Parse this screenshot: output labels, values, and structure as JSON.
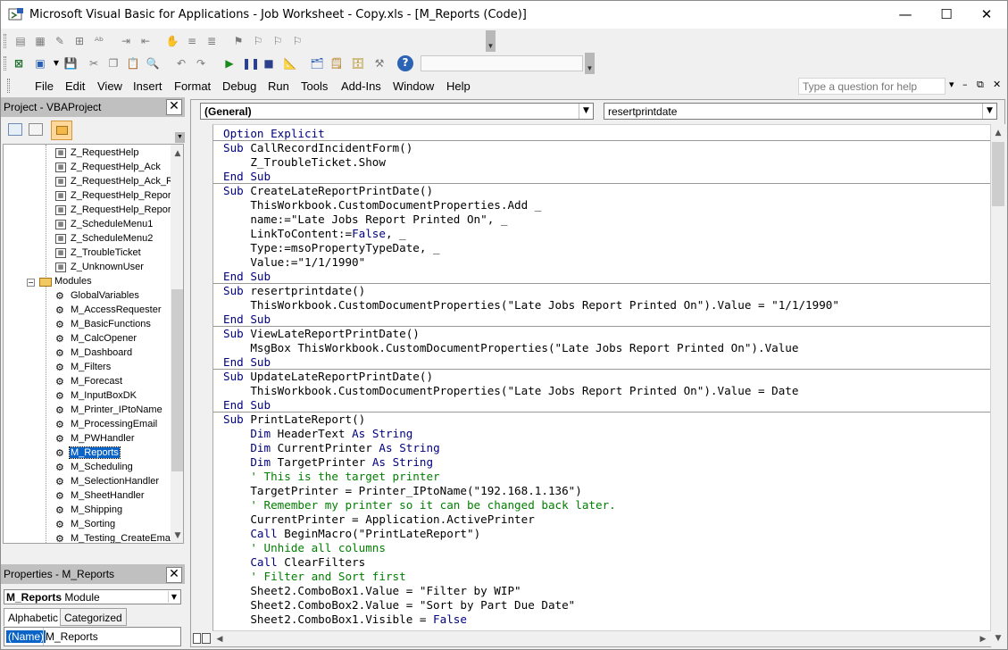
{
  "window": {
    "title": "Microsoft Visual Basic for Applications - Job Worksheet - Copy.xls - [M_Reports (Code)]",
    "minimize": "—",
    "maximize": "☐",
    "close": "✕"
  },
  "menubar": {
    "items": [
      "File",
      "Edit",
      "View",
      "Insert",
      "Format",
      "Debug",
      "Run",
      "Tools",
      "Add-Ins",
      "Window",
      "Help"
    ],
    "help_placeholder": "Type a question for help",
    "mdi_minimize": "–",
    "mdi_restore": "⧉",
    "mdi_close": "✕"
  },
  "project_pane": {
    "title": "Project - VBAProject",
    "close": "✕",
    "tree": [
      {
        "label": "Z_RequestHelp",
        "kind": "form"
      },
      {
        "label": "Z_RequestHelp_Ack",
        "kind": "form"
      },
      {
        "label": "Z_RequestHelp_Ack_R",
        "kind": "form"
      },
      {
        "label": "Z_RequestHelp_Repor",
        "kind": "form"
      },
      {
        "label": "Z_RequestHelp_Repor",
        "kind": "form"
      },
      {
        "label": "Z_ScheduleMenu1",
        "kind": "form"
      },
      {
        "label": "Z_ScheduleMenu2",
        "kind": "form"
      },
      {
        "label": "Z_TroubleTicket",
        "kind": "form"
      },
      {
        "label": "Z_UnknownUser",
        "kind": "form"
      },
      {
        "label": "Modules",
        "kind": "folder"
      },
      {
        "label": "GlobalVariables",
        "kind": "module"
      },
      {
        "label": "M_AccessRequester",
        "kind": "module"
      },
      {
        "label": "M_BasicFunctions",
        "kind": "module"
      },
      {
        "label": "M_CalcOpener",
        "kind": "module"
      },
      {
        "label": "M_Dashboard",
        "kind": "module"
      },
      {
        "label": "M_Filters",
        "kind": "module"
      },
      {
        "label": "M_Forecast",
        "kind": "module"
      },
      {
        "label": "M_InputBoxDK",
        "kind": "module"
      },
      {
        "label": "M_Printer_IPtoName",
        "kind": "module"
      },
      {
        "label": "M_ProcessingEmail",
        "kind": "module"
      },
      {
        "label": "M_PWHandler",
        "kind": "module"
      },
      {
        "label": "M_Reports",
        "kind": "module",
        "selected": true
      },
      {
        "label": "M_Scheduling",
        "kind": "module"
      },
      {
        "label": "M_SelectionHandler",
        "kind": "module"
      },
      {
        "label": "M_SheetHandler",
        "kind": "module"
      },
      {
        "label": "M_Shipping",
        "kind": "module"
      },
      {
        "label": "M_Sorting",
        "kind": "module"
      },
      {
        "label": "M_Testing_CreateEma",
        "kind": "module"
      }
    ]
  },
  "properties_pane": {
    "title": "Properties - M_Reports",
    "close": "✕",
    "object_name": "M_Reports",
    "object_type": "Module",
    "tabs": [
      "Alphabetic",
      "Categorized"
    ],
    "prop_name": "(Name)",
    "prop_value": "M_Reports"
  },
  "code_window": {
    "object_combo": "(General)",
    "procedure_combo": "resertprintdate",
    "lines": [
      {
        "t": "Option Explicit",
        "k": "kw"
      },
      {
        "t": "Sub CallRecordIncidentForm()",
        "k": "sub",
        "sep": true
      },
      {
        "t": "    Z_TroubleTicket.Show",
        "k": ""
      },
      {
        "t": "End Sub",
        "k": "kw"
      },
      {
        "t": "Sub CreateLateReportPrintDate()",
        "k": "sub",
        "sep": true
      },
      {
        "t": "    ThisWorkbook.CustomDocumentProperties.Add _",
        "k": ""
      },
      {
        "t": "    name:=\"Late Jobs Report Printed On\", _",
        "k": ""
      },
      {
        "t": "    LinkToContent:=False, _",
        "k": "false"
      },
      {
        "t": "    Type:=msoPropertyTypeDate, _",
        "k": ""
      },
      {
        "t": "    Value:=\"1/1/1990\"",
        "k": ""
      },
      {
        "t": "End Sub",
        "k": "kw"
      },
      {
        "t": "Sub resertprintdate()",
        "k": "sub",
        "sep": true
      },
      {
        "t": "    ThisWorkbook.CustomDocumentProperties(\"Late Jobs Report Printed On\").Value = \"1/1/1990\"",
        "k": ""
      },
      {
        "t": "End Sub",
        "k": "kw"
      },
      {
        "t": "Sub ViewLateReportPrintDate()",
        "k": "sub",
        "sep": true
      },
      {
        "t": "    MsgBox ThisWorkbook.CustomDocumentProperties(\"Late Jobs Report Printed On\").Value",
        "k": ""
      },
      {
        "t": "End Sub",
        "k": "kw"
      },
      {
        "t": "Sub UpdateLateReportPrintDate()",
        "k": "sub",
        "sep": true
      },
      {
        "t": "    ThisWorkbook.CustomDocumentProperties(\"Late Jobs Report Printed On\").Value = Date",
        "k": ""
      },
      {
        "t": "End Sub",
        "k": "kw"
      },
      {
        "t": "Sub PrintLateReport()",
        "k": "sub",
        "sep": true
      },
      {
        "t": "    Dim HeaderText As String",
        "k": "dim"
      },
      {
        "t": "    Dim CurrentPrinter As String",
        "k": "dim"
      },
      {
        "t": "    Dim TargetPrinter As String",
        "k": "dim"
      },
      {
        "t": "    ' This is the target printer",
        "k": "cm"
      },
      {
        "t": "    TargetPrinter = Printer_IPtoName(\"192.168.1.136\")",
        "k": ""
      },
      {
        "t": "    ' Remember my printer so it can be changed back later.",
        "k": "cm"
      },
      {
        "t": "    CurrentPrinter = Application.ActivePrinter",
        "k": ""
      },
      {
        "t": "    Call BeginMacro(\"PrintLateReport\")",
        "k": "call"
      },
      {
        "t": "    ' Unhide all columns",
        "k": "cm"
      },
      {
        "t": "    Call ClearFilters",
        "k": "call"
      },
      {
        "t": "    ' Filter and Sort first",
        "k": "cm"
      },
      {
        "t": "    Sheet2.ComboBox1.Value = \"Filter by WIP\"",
        "k": ""
      },
      {
        "t": "    Sheet2.ComboBox2.Value = \"Sort by Part Due Date\"",
        "k": ""
      },
      {
        "t": "    Sheet2.ComboBox1.Visible = False",
        "k": "false"
      }
    ]
  },
  "colors": {
    "keyword": "#00007f",
    "comment": "#007f00",
    "selection": "#0a64c8"
  }
}
